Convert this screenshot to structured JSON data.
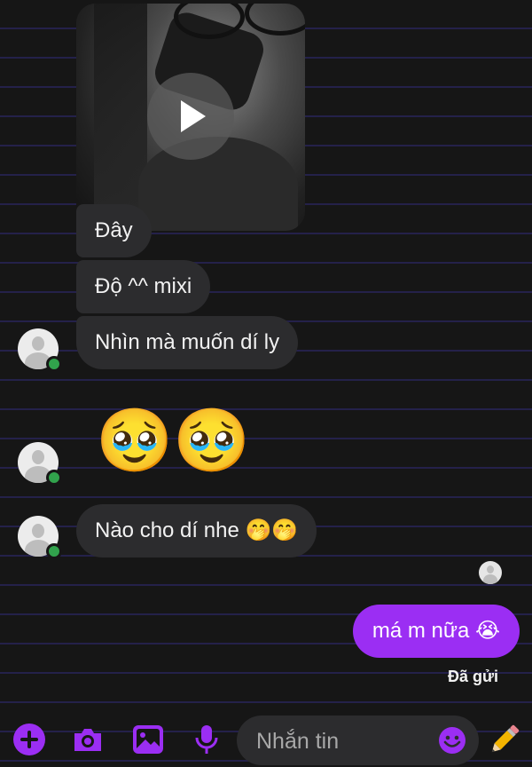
{
  "conversation": {
    "messages": [
      {
        "type": "video",
        "sender": "contact"
      },
      {
        "type": "text",
        "sender": "contact",
        "text": "Đây"
      },
      {
        "type": "text",
        "sender": "contact",
        "text": "Độ ^^ mixi"
      },
      {
        "type": "text",
        "sender": "contact",
        "text": "Nhìn mà muốn dí ly"
      },
      {
        "type": "emoji",
        "sender": "contact",
        "text": "🥹🥹"
      },
      {
        "type": "text",
        "sender": "contact",
        "text": "Nào cho dí nhe 🤭🤭"
      },
      {
        "type": "text",
        "sender": "me",
        "text": "má m nữa 😭"
      }
    ],
    "status": "Đã gửi"
  },
  "composer": {
    "placeholder": "Nhắn tin",
    "icons": [
      "plus-icon",
      "camera-icon",
      "image-icon",
      "microphone-icon",
      "emoji-icon",
      "pencil-icon"
    ]
  },
  "colors": {
    "accent": "#9b2ef3",
    "incoming_bubble": "#2c2c2e",
    "background": "#161616",
    "online": "#31a24c"
  }
}
